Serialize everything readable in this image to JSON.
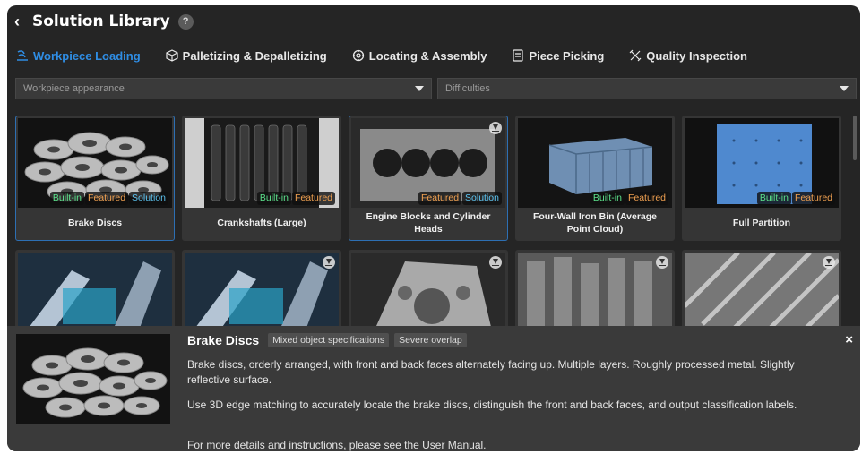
{
  "window": {
    "title": "Solution Library",
    "help": "?",
    "back": "‹"
  },
  "tabs": [
    {
      "label": "Workpiece Loading",
      "active": true,
      "icon": "loading-icon"
    },
    {
      "label": "Palletizing & Depalletizing",
      "active": false,
      "icon": "box-icon"
    },
    {
      "label": "Locating & Assembly",
      "active": false,
      "icon": "gear-icon"
    },
    {
      "label": "Piece Picking",
      "active": false,
      "icon": "list-icon"
    },
    {
      "label": "Quality Inspection",
      "active": false,
      "icon": "inspect-icon"
    }
  ],
  "filters": {
    "appearance": "Workpiece appearance",
    "difficulties": "Difficulties"
  },
  "cards": [
    {
      "name": "Brake Discs",
      "badges": [
        "Built-in",
        "Featured",
        "Solution"
      ],
      "download": false
    },
    {
      "name": "Crankshafts (Large)",
      "badges": [
        "Built-in",
        "Featured"
      ],
      "download": false
    },
    {
      "name": "Engine Blocks and Cylinder Heads",
      "badges": [
        "Featured",
        "Solution"
      ],
      "download": true
    },
    {
      "name": "Four-Wall Iron Bin (Average Point Cloud)",
      "badges": [
        "Built-in",
        "Featured"
      ],
      "download": false
    },
    {
      "name": "Full Partition",
      "badges": [
        "Built-in",
        "Featured"
      ],
      "download": false
    }
  ],
  "detail": {
    "title": "Brake Discs",
    "tags": [
      "Mixed object specifications",
      "Severe overlap"
    ],
    "para1": "Brake discs, orderly arranged, with front and back faces alternately facing up. Multiple layers. Roughly processed metal. Slightly reflective surface.",
    "para2": "Use 3D edge matching to accurately locate the brake discs, distinguish the front and back faces, and output classification labels.",
    "para3": "For more details and instructions, please see the User Manual.",
    "close": "×"
  },
  "colors": {
    "accent": "#2f8de4",
    "builtin": "#5be08a",
    "featured": "#f0a050",
    "solution": "#5cc3f0"
  }
}
